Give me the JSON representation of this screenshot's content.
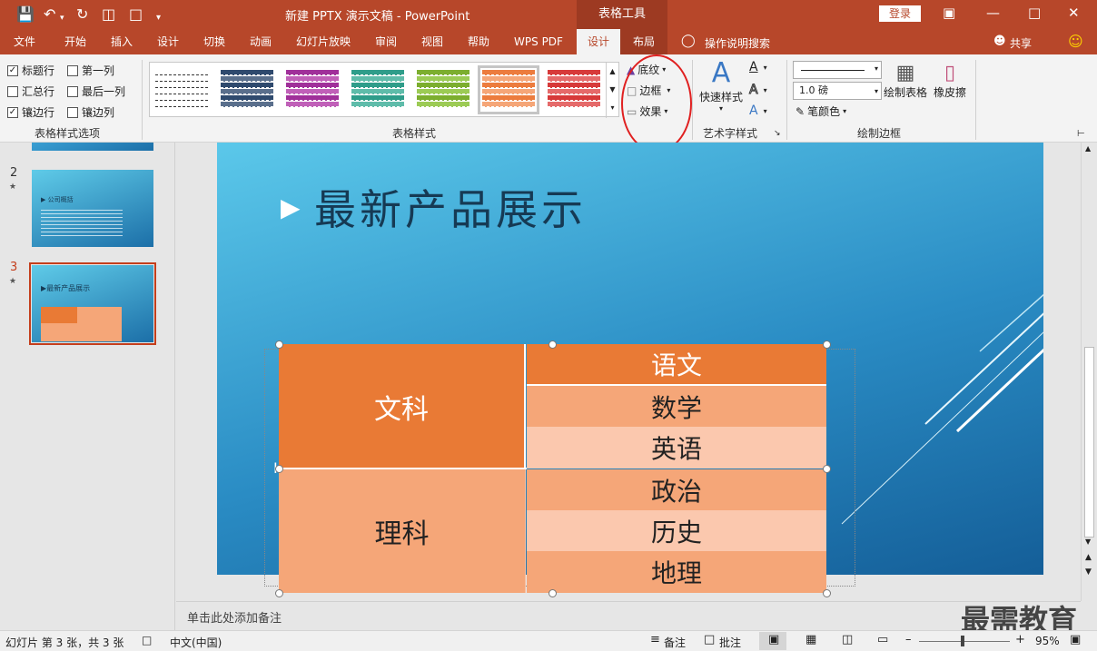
{
  "titlebar": {
    "title": "新建 PPTX 演示文稿 - PowerPoint",
    "context_tab_title": "表格工具",
    "login_label": "登录"
  },
  "tabs": [
    "文件",
    "开始",
    "插入",
    "设计",
    "切换",
    "动画",
    "幻灯片放映",
    "审阅",
    "视图",
    "帮助",
    "WPS PDF",
    "设计",
    "布局"
  ],
  "tell_me": "操作说明搜索",
  "share": "共享",
  "style_options": {
    "items": [
      {
        "label": "标题行",
        "checked": true
      },
      {
        "label": "第一列",
        "checked": false
      },
      {
        "label": "汇总行",
        "checked": false
      },
      {
        "label": "最后一列",
        "checked": false
      },
      {
        "label": "镶边行",
        "checked": true
      },
      {
        "label": "镶边列",
        "checked": false
      }
    ],
    "group_label": "表格样式选项"
  },
  "table_styles": {
    "group_label": "表格样式",
    "swatches": [
      {
        "head": "#ffffff",
        "band": "#ffffff",
        "line": "#333333"
      },
      {
        "head": "#2f4a6e",
        "band": "#5a6f8c",
        "line": "#ffffff"
      },
      {
        "head": "#a0309a",
        "band": "#c060b8",
        "line": "#ffffff"
      },
      {
        "head": "#2f9d8a",
        "band": "#5fbcaa",
        "line": "#ffffff"
      },
      {
        "head": "#7cae2f",
        "band": "#9ccb55",
        "line": "#ffffff"
      },
      {
        "head": "#ec7c3e",
        "band": "#f5a678",
        "line": "#ffffff"
      },
      {
        "head": "#d73a3a",
        "band": "#e56a6a",
        "line": "#ffffff"
      }
    ],
    "shading_label": "底纹",
    "borders_label": "边框",
    "effects_label": "效果"
  },
  "wordart": {
    "quick_styles_label": "快速样式",
    "group_label": "艺术字样式"
  },
  "draw_borders": {
    "pen_weight": "1.0 磅",
    "pen_color_label": "笔颜色",
    "draw_table_label": "绘制表格",
    "eraser_label": "橡皮擦",
    "group_label": "绘制边框"
  },
  "slides": [
    {
      "number": "2",
      "star": "★",
      "title": "公司概括"
    },
    {
      "number": "3",
      "star": "★",
      "title": "最新产品展示"
    }
  ],
  "slide": {
    "title": "最新产品展示",
    "table": {
      "groups": [
        {
          "name": "文科",
          "subjects": [
            "语文",
            "数学",
            "英语"
          ]
        },
        {
          "name": "理科",
          "subjects": [
            "政治",
            "历史",
            "地理"
          ]
        }
      ]
    }
  },
  "notes_placeholder": "单击此处添加备注",
  "status": {
    "slide_info": "幻灯片 第 3 张，共 3 张",
    "language": "中文(中国)",
    "notes_label": "备注",
    "comments_label": "批注",
    "zoom": "95%"
  },
  "watermark": "最需教育",
  "colors": {
    "brand": "#b7472a",
    "table_header": "#e97a35",
    "table_light": "#f5a678",
    "table_lighter": "#fbc8ae"
  }
}
